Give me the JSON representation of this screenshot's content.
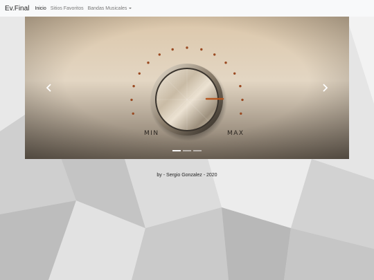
{
  "navbar": {
    "brand": "Ev.Final",
    "links": [
      {
        "label": "Inicio"
      },
      {
        "label": "Sitios Favoritos"
      },
      {
        "label": "Bandas Musicales"
      }
    ]
  },
  "carousel": {
    "slide": {
      "knob_min_label": "MIN",
      "knob_max_label": "MAX"
    },
    "prev_icon": "chevron-left-icon",
    "next_icon": "chevron-right-icon",
    "active_index": 0,
    "indicator_count": 3
  },
  "footer": {
    "credit": "by - Sergio Gonzalez - 2020"
  },
  "colors": {
    "navbar_bg": "#f8f9fa",
    "accent_line": "#b5561f"
  }
}
